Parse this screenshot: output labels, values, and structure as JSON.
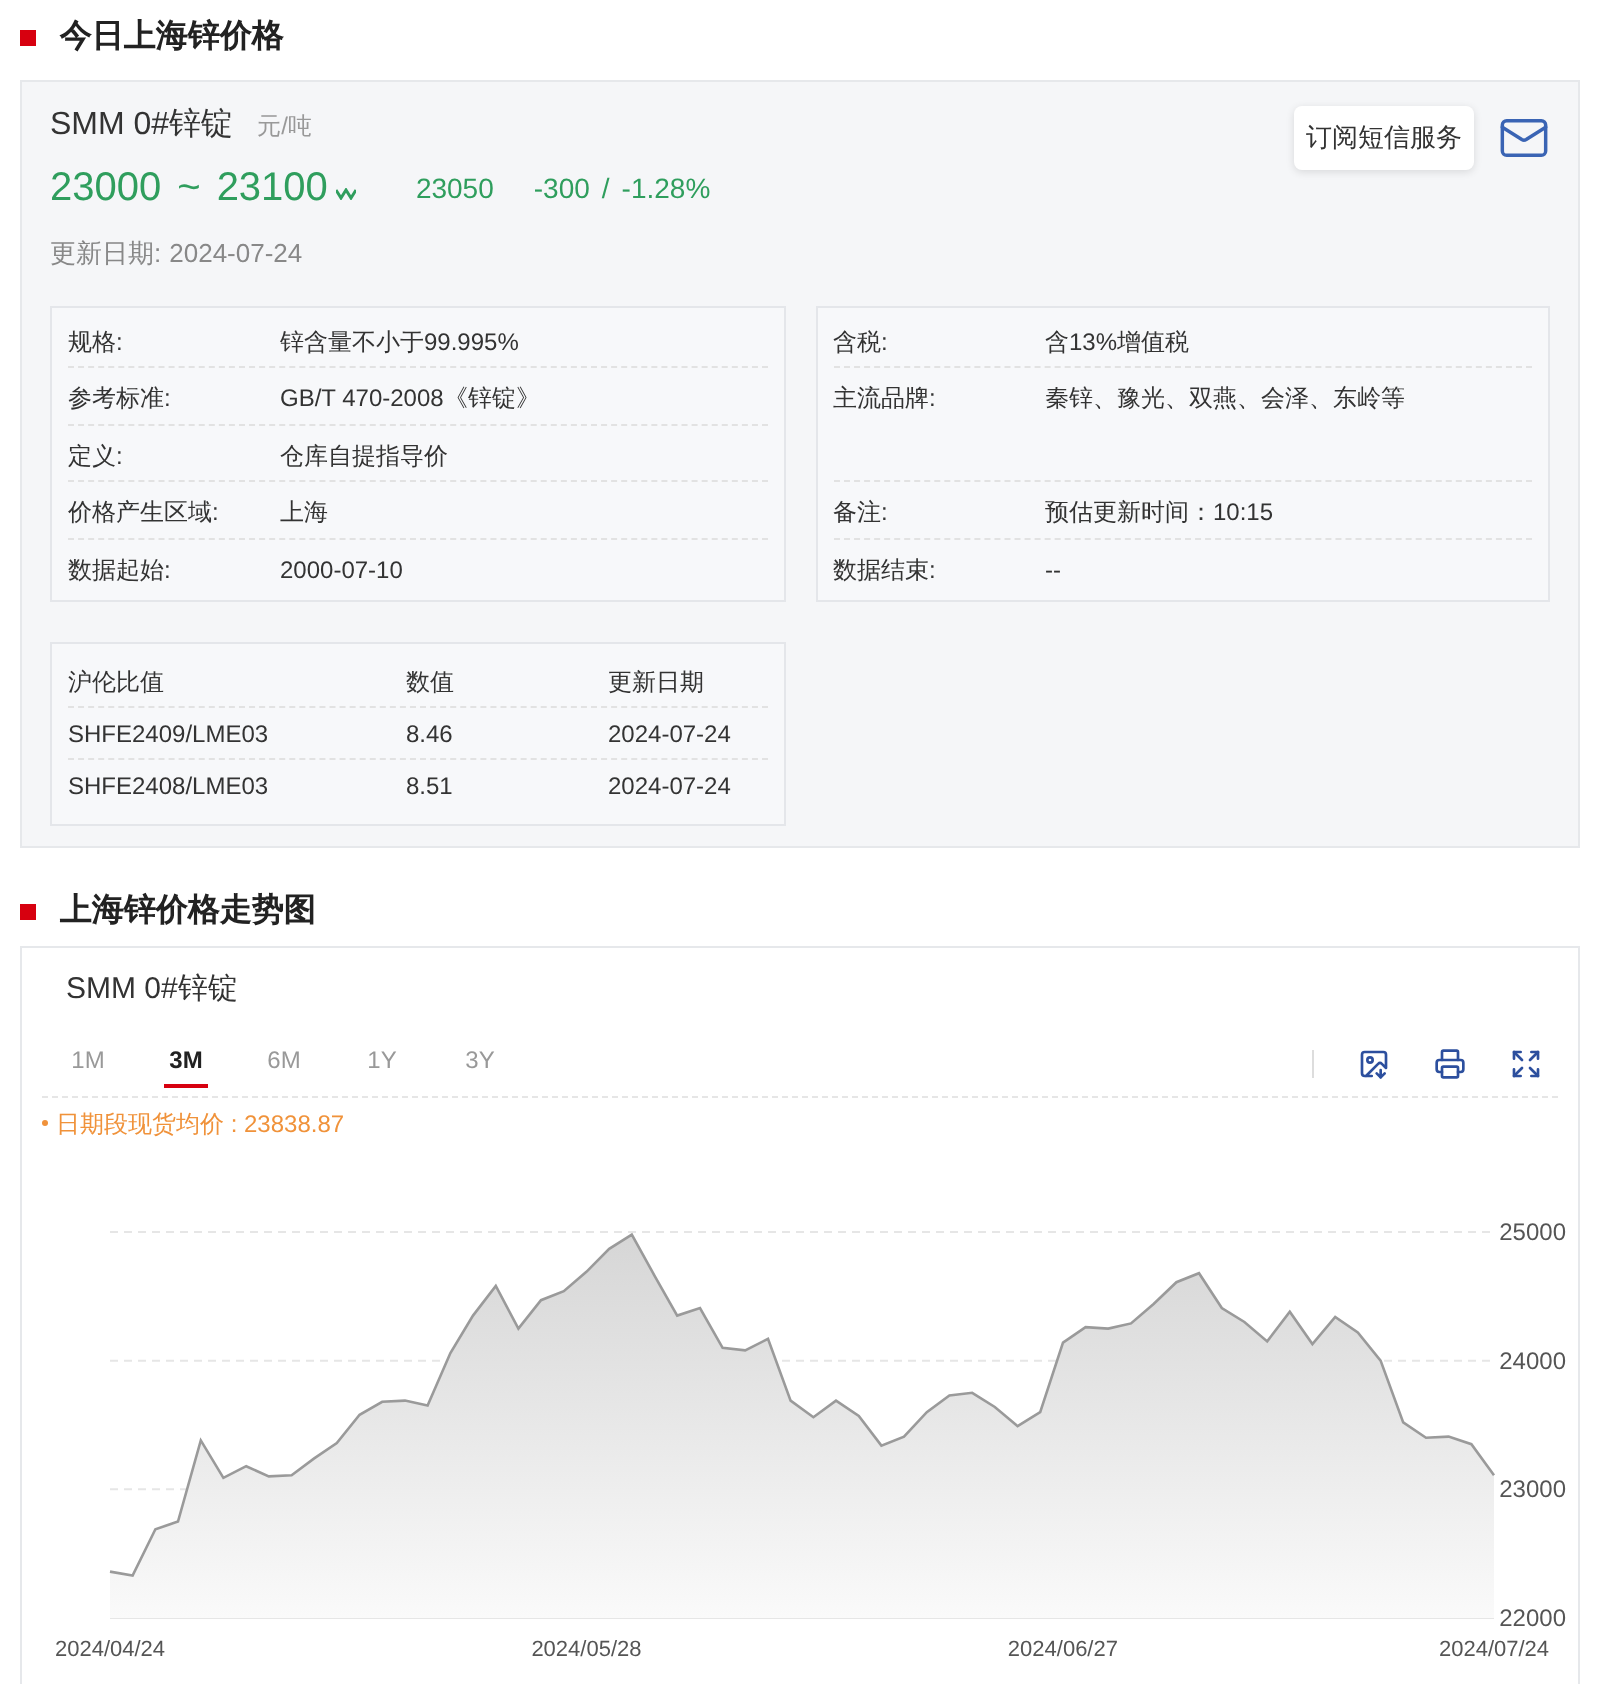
{
  "price_section": {
    "title": "今日上海锌价格",
    "product": "SMM 0#锌锭",
    "unit": "元/吨",
    "price_low": "23000",
    "separator": "~",
    "price_high": "23100",
    "average": "23050",
    "change": "-300",
    "change_divider": "/",
    "change_percent": "-1.28%",
    "updated_label": "更新日期:",
    "updated_date": "2024-07-24",
    "subscribe_button": "订阅短信服务",
    "spec_left": [
      {
        "label": "规格:",
        "value": "锌含量不小于99.995%"
      },
      {
        "label": "参考标准:",
        "value": "GB/T 470-2008《锌锭》"
      },
      {
        "label": "定义:",
        "value": "仓库自提指导价"
      },
      {
        "label": "价格产生区域:",
        "value": "上海"
      },
      {
        "label": "数据起始:",
        "value": "2000-07-10"
      }
    ],
    "spec_right": [
      {
        "label": "含税:",
        "value": "含13%增值税"
      },
      {
        "label": "主流品牌:",
        "value": "秦锌、豫光、双燕、会泽、东岭等"
      },
      {
        "label": "备注:",
        "value": "预估更新时间：10:15"
      },
      {
        "label": "数据结束:",
        "value": "--"
      }
    ],
    "ratio_table": {
      "columns": [
        "沪伦比值",
        "数值",
        "更新日期"
      ],
      "rows": [
        [
          "SHFE2409/LME03",
          "8.46",
          "2024-07-24"
        ],
        [
          "SHFE2408/LME03",
          "8.51",
          "2024-07-24"
        ]
      ]
    }
  },
  "chart_section": {
    "title": "上海锌价格走势图",
    "product": "SMM 0#锌锭",
    "tabs": [
      {
        "label": "1M",
        "selected": false
      },
      {
        "label": "3M",
        "selected": true
      },
      {
        "label": "6M",
        "selected": false
      },
      {
        "label": "1Y",
        "selected": false
      },
      {
        "label": "3Y",
        "selected": false
      }
    ],
    "legend": "日期段现货均价 : 23838.87",
    "chart_data": {
      "type": "area",
      "grid": true,
      "ylim": [
        22000,
        25000
      ],
      "yticks": [
        22000,
        23000,
        24000,
        25000
      ],
      "categories": [
        "2024/04/24",
        null,
        null,
        null,
        null,
        null,
        null,
        null,
        null,
        null,
        null,
        null,
        null,
        null,
        null,
        null,
        null,
        null,
        null,
        null,
        null,
        "2024/05/28",
        null,
        null,
        null,
        null,
        null,
        null,
        null,
        null,
        null,
        null,
        null,
        null,
        null,
        null,
        null,
        null,
        null,
        null,
        null,
        null,
        "2024/06/27",
        null,
        null,
        null,
        null,
        null,
        null,
        null,
        null,
        null,
        null,
        null,
        null,
        null,
        null,
        null,
        null,
        null,
        null,
        "2024/07/24"
      ],
      "values": [
        22360,
        22330,
        22690,
        22750,
        23380,
        23090,
        23180,
        23100,
        23110,
        23240,
        23360,
        23580,
        23680,
        23690,
        23650,
        24060,
        24350,
        24580,
        24250,
        24470,
        24540,
        24690,
        24870,
        24980,
        24660,
        24350,
        24410,
        24100,
        24080,
        24170,
        23690,
        23560,
        23690,
        23570,
        23340,
        23410,
        23600,
        23730,
        23750,
        23640,
        23490,
        23600,
        24140,
        24260,
        24250,
        24290,
        24440,
        24610,
        24680,
        24410,
        24300,
        24150,
        24380,
        24130,
        24340,
        24220,
        24000,
        23520,
        23400,
        23410,
        23350,
        23110
      ]
    }
  }
}
